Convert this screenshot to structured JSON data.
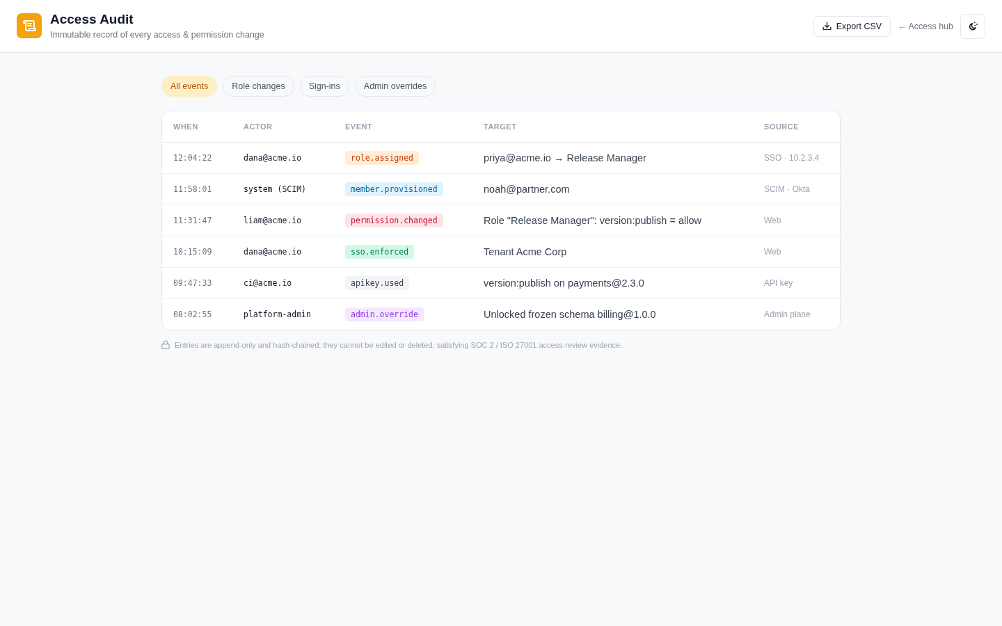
{
  "header": {
    "title": "Access Audit",
    "subtitle": "Immutable record of every access & permission change",
    "export_button": "Export CSV",
    "back_link": "← Access hub"
  },
  "filters": [
    {
      "label": "All events",
      "selected": true
    },
    {
      "label": "Role changes",
      "selected": false
    },
    {
      "label": "Sign-ins",
      "selected": false
    },
    {
      "label": "Admin overrides",
      "selected": false
    }
  ],
  "table": {
    "columns": [
      "WHEN",
      "ACTOR",
      "EVENT",
      "TARGET",
      "SOURCE"
    ],
    "rows": [
      {
        "when": "12:04:22",
        "actor": "dana@acme.io",
        "event": {
          "label": "role.assigned",
          "kind": "role"
        },
        "target": "priya@acme.io → Release Manager",
        "source": "SSO · 10.2.3.4"
      },
      {
        "when": "11:58:01",
        "actor": "system (SCIM)",
        "event": {
          "label": "member.provisioned",
          "kind": "provisioning"
        },
        "target": "noah@partner.com",
        "source": "SCIM · Okta"
      },
      {
        "when": "11:31:47",
        "actor": "liam@acme.io",
        "event": {
          "label": "permission.changed",
          "kind": "permission"
        },
        "target": "Role \"Release Manager\": version:publish = allow",
        "source": "Web"
      },
      {
        "when": "10:15:09",
        "actor": "dana@acme.io",
        "event": {
          "label": "sso.enforced",
          "kind": "sso"
        },
        "target": "Tenant Acme Corp",
        "source": "Web"
      },
      {
        "when": "09:47:33",
        "actor": "ci@acme.io",
        "event": {
          "label": "apikey.used",
          "kind": "apikey"
        },
        "target": "version:publish on payments@2.3.0",
        "source": "API key"
      },
      {
        "when": "08:02:55",
        "actor": "platform-admin",
        "event": {
          "label": "admin.override",
          "kind": "override"
        },
        "target": "Unlocked frozen schema billing@1.0.0",
        "source": "Admin plane"
      }
    ]
  },
  "footnote": "Entries are append-only and hash-chained; they cannot be edited or deleted, satisfying SOC 2 / ISO 27001 access-review evidence."
}
